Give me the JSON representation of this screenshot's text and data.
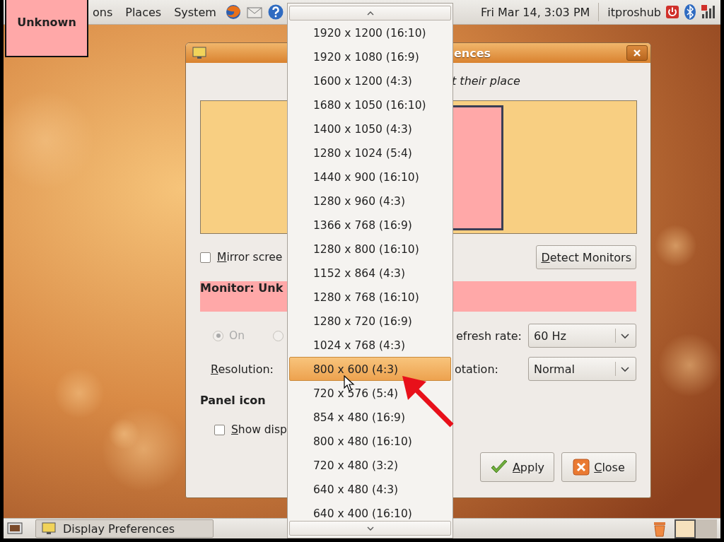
{
  "top_panel": {
    "menus": [
      "ons",
      "Places",
      "System"
    ],
    "clock": "Fri Mar 14, 3:03 PM",
    "user": "itproshub"
  },
  "overlay_label": "Unknown",
  "dialog": {
    "title": "ences",
    "hint": "t their place",
    "mirror": {
      "label": "Mirror scree",
      "checked": false
    },
    "detect_button": "Detect Monitors",
    "monitor_header": "Monitor: Unk",
    "power_options": [
      {
        "label": "On",
        "selected": true,
        "disabled": true
      },
      {
        "selected": false,
        "disabled": true
      }
    ],
    "refresh_label": "efresh rate:",
    "refresh_value": "60 Hz",
    "resolution_label": "Resolution:",
    "rotation_label": "otation:",
    "rotation_value": "Normal",
    "panel_heading": "Panel icon",
    "show_icon": {
      "label": "Show disp",
      "checked": false
    },
    "buttons": [
      {
        "label": "Apply",
        "kind": "apply"
      },
      {
        "label": "Close",
        "kind": "close"
      }
    ]
  },
  "dropdown": {
    "items": [
      {
        "label": "1920 x 1200 (16:10)",
        "selected": false
      },
      {
        "label": "1920 x 1080 (16:9)",
        "selected": false
      },
      {
        "label": "1600 x 1200 (4:3)",
        "selected": false
      },
      {
        "label": "1680 x 1050 (16:10)",
        "selected": false
      },
      {
        "label": "1400 x 1050 (4:3)",
        "selected": false
      },
      {
        "label": "1280 x 1024 (5:4)",
        "selected": false
      },
      {
        "label": "1440 x 900 (16:10)",
        "selected": false
      },
      {
        "label": "1280 x 960 (4:3)",
        "selected": false
      },
      {
        "label": "1366 x 768 (16:9)",
        "selected": false
      },
      {
        "label": "1280 x 800 (16:10)",
        "selected": false
      },
      {
        "label": "1152 x 864 (4:3)",
        "selected": false
      },
      {
        "label": "1280 x 768 (16:10)",
        "selected": false
      },
      {
        "label": "1280 x 720 (16:9)",
        "selected": false
      },
      {
        "label": "1024 x 768 (4:3)",
        "selected": false
      },
      {
        "label": "800 x 600 (4:3)",
        "selected": true
      },
      {
        "label": "720 x 576 (5:4)",
        "selected": false
      },
      {
        "label": "854 x 480 (16:9)",
        "selected": false
      },
      {
        "label": "800 x 480 (16:10)",
        "selected": false
      },
      {
        "label": "720 x 480 (3:2)",
        "selected": false
      },
      {
        "label": "640 x 480 (4:3)",
        "selected": false
      },
      {
        "label": "640 x 400 (16:10)",
        "selected": false
      }
    ]
  },
  "taskbar": {
    "tasks": [
      {
        "label": "Display Preferences"
      }
    ]
  }
}
